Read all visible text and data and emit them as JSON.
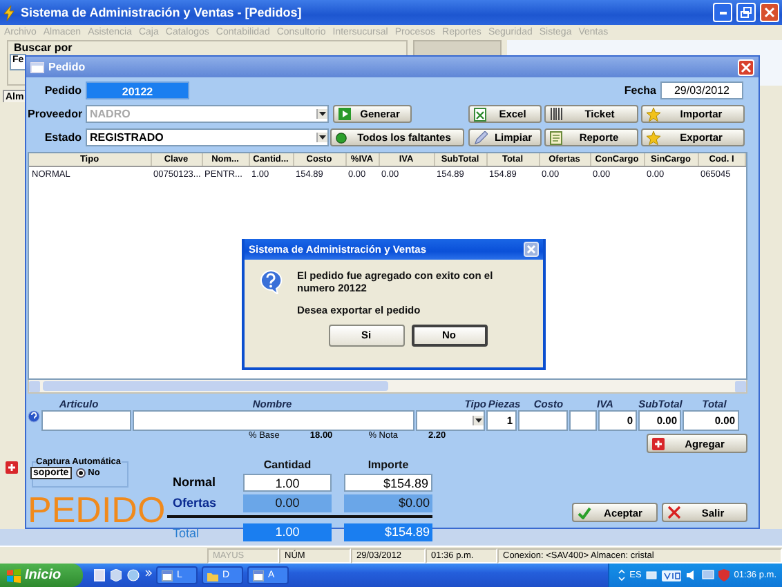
{
  "app_window": {
    "title": "Sistema de  Administración y Ventas - [Pedidos]"
  },
  "menu": [
    {
      "label": "Archivo",
      "disabled": true
    },
    {
      "label": "Almacen",
      "disabled": true
    },
    {
      "label": "Asistencia",
      "disabled": true
    },
    {
      "label": "Caja",
      "disabled": true
    },
    {
      "label": "Catalogos",
      "disabled": true
    },
    {
      "label": "Contabilidad",
      "disabled": true
    },
    {
      "label": "Consultorio",
      "disabled": true
    },
    {
      "label": "Intersucursal",
      "disabled": true
    },
    {
      "label": "Procesos",
      "disabled": true
    },
    {
      "label": "Reportes",
      "disabled": true
    },
    {
      "label": "Seguridad",
      "disabled": true
    },
    {
      "label": "Sistega",
      "disabled": true
    },
    {
      "label": "Ventas",
      "disabled": true
    }
  ],
  "background_form": {
    "search_group_label": "Buscar por",
    "search_field_value": "Fe",
    "tab_label": "Alm"
  },
  "pedido_window": {
    "title": "Pedido",
    "order_label": "Pedido",
    "order_number": "20122",
    "date_label": "Fecha",
    "date": "29/03/2012",
    "supplier_label": "Proveedor",
    "supplier": "NADRO",
    "supplier_disabled": true,
    "status_label": "Estado",
    "status": "REGISTRADO",
    "generate_button": "Generar",
    "all_missing_button": "Todos los faltantes",
    "tool_buttons": [
      "Excel",
      "Ticket",
      "Importar",
      "Limpiar",
      "Reporte",
      "Exportar"
    ],
    "table": {
      "columns": [
        "Tipo",
        "Clave",
        "Nom...",
        "Cantid...",
        "Costo",
        "%IVA",
        "IVA",
        "SubTotal",
        "Total",
        "Ofertas",
        "ConCargo",
        "SinCargo",
        "Cod. I"
      ],
      "rows": [
        [
          "NORMAL",
          "00750123...",
          "PENTR...",
          "1.00",
          "154.89",
          "0.00",
          "0.00",
          "154.89",
          "154.89",
          "0.00",
          "0.00",
          "0.00",
          "065045"
        ]
      ]
    },
    "entry_labels": [
      "Articulo",
      "Nombre",
      "Tipo",
      "Piezas",
      "Costo",
      "IVA",
      "SubTotal",
      "Total"
    ],
    "entry_values": {
      "piezas": "1",
      "iva": "0",
      "subtotal": "0.00",
      "total": "0.00"
    },
    "rates": [
      {
        "label": "% Base",
        "value": "18.00"
      },
      {
        "label": "% Nota",
        "value": "2.20"
      }
    ],
    "add_button": "Agregar",
    "auto_capture": {
      "label": "Captura Automática",
      "user": "soporte",
      "option": {
        "label": "No",
        "selected": true
      }
    },
    "stamp": "PEDIDO",
    "summary": {
      "headers": [
        "Cantidad",
        "Importe"
      ],
      "rows": [
        {
          "kind": "normal",
          "label": "Normal",
          "quantity": "1.00",
          "amount": "$154.89"
        },
        {
          "kind": "offers",
          "label": "Ofertas",
          "quantity": "0.00",
          "amount": "$0.00"
        },
        {
          "kind": "total",
          "label": "Total",
          "quantity": "1.00",
          "amount": "$154.89"
        }
      ]
    },
    "accept_button": "Aceptar",
    "exit_button": "Salir"
  },
  "dialog": {
    "title": "Sistema de Administración y Ventas",
    "message": "El pedido fue agregado con exito con el numero 20122",
    "question": "Desea exportar el pedido",
    "buttons": [
      {
        "label": "Si",
        "selected": false
      },
      {
        "label": "No",
        "selected": true
      }
    ]
  },
  "status_bar": [
    {
      "text": "MAYUS",
      "disabled": true
    },
    {
      "text": "NÚM",
      "disabled": false
    },
    {
      "text": "29/03/2012",
      "disabled": false
    },
    {
      "text": "01:36 p.m.",
      "disabled": false
    },
    {
      "text": "Conexion: <SAV400> Almacen: cristal",
      "disabled": false
    }
  ],
  "taskbar": {
    "start": "Inicio",
    "tasks": [
      "L",
      "D",
      "A"
    ],
    "language": "ES",
    "clock": "01:36 p.m."
  }
}
